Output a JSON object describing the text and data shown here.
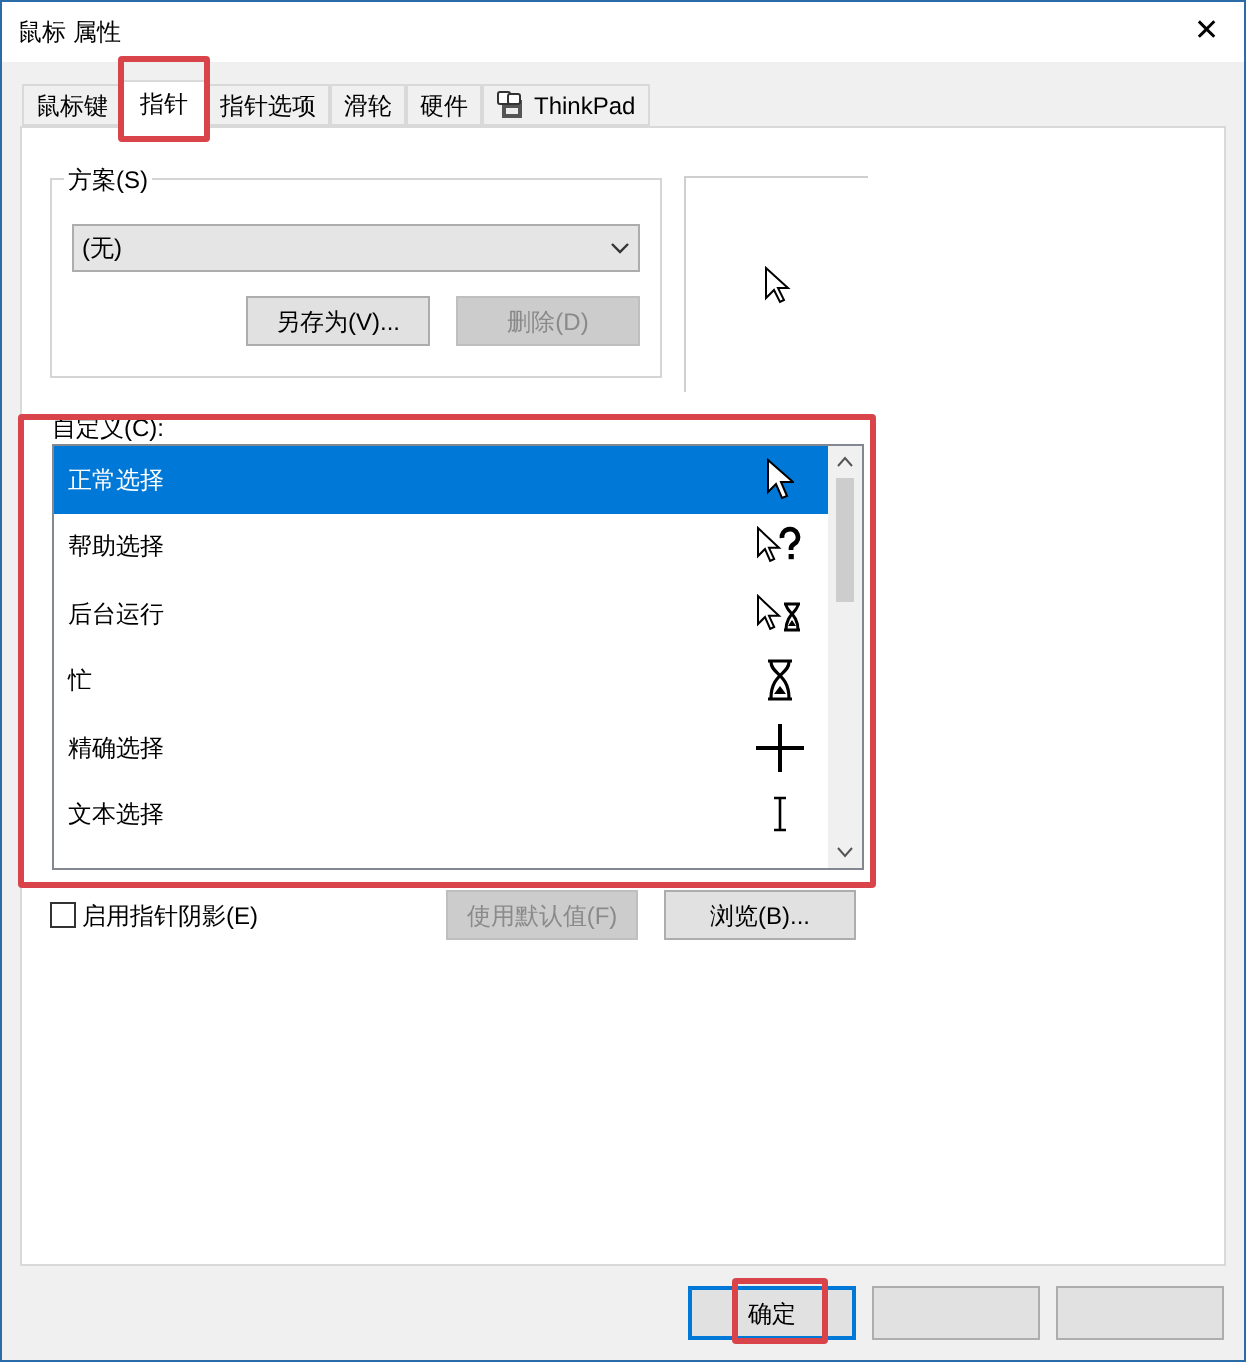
{
  "window": {
    "title": "鼠标 属性",
    "close": "✕"
  },
  "tabs": [
    {
      "label": "鼠标键",
      "selected": false,
      "highlighted": false
    },
    {
      "label": "指针",
      "selected": true,
      "highlighted": true
    },
    {
      "label": "指针选项",
      "selected": false,
      "highlighted": false
    },
    {
      "label": "滑轮",
      "selected": false,
      "highlighted": false
    },
    {
      "label": "硬件",
      "selected": false,
      "highlighted": false
    },
    {
      "label": "ThinkPad",
      "selected": false,
      "highlighted": false,
      "kind": "with_icon"
    }
  ],
  "scheme": {
    "label": "方案(S)",
    "value": "(无)",
    "buttons": [
      {
        "label": "另存为(V)...",
        "disabled": false
      },
      {
        "label": "删除(D)",
        "disabled": true
      }
    ]
  },
  "customize": {
    "label": "自定义(C):",
    "highlighted": true,
    "rows": [
      {
        "label": "正常选择",
        "kind": "arrow",
        "selected": true
      },
      {
        "label": "帮助选择",
        "kind": "help",
        "selected": false
      },
      {
        "label": "后台运行",
        "kind": "working",
        "selected": false
      },
      {
        "label": "忙",
        "kind": "busy",
        "selected": false
      },
      {
        "label": "精确选择",
        "kind": "cross",
        "selected": false
      },
      {
        "label": "文本选择",
        "kind": "beam",
        "selected": false
      }
    ]
  },
  "shadow": {
    "label": "启用指针阴影(E)",
    "checked": false
  },
  "list_buttons": [
    {
      "label": "使用默认值(F)",
      "disabled": true
    },
    {
      "label": "浏览(B)...",
      "disabled": false
    }
  ],
  "footer_buttons": [
    {
      "label": "确定",
      "highlighted": true,
      "default": true
    },
    {
      "default": false,
      "highlighted": false
    },
    {
      "default": false,
      "highlighted": false
    }
  ]
}
